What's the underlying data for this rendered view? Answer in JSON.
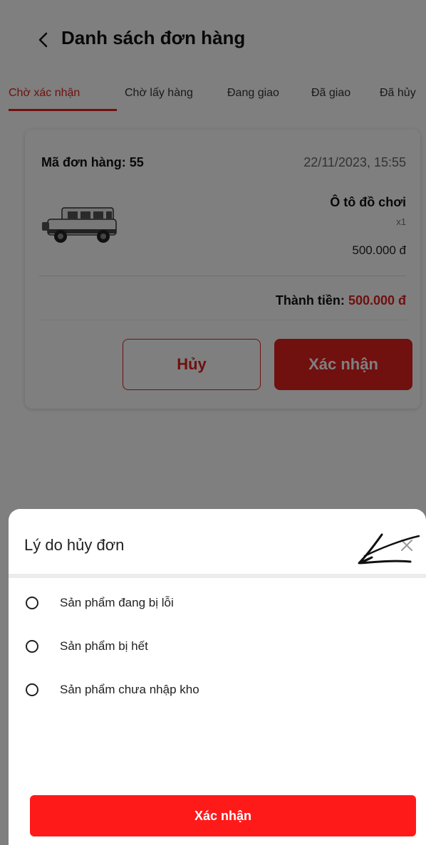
{
  "header": {
    "title": "Danh sách đơn hàng"
  },
  "tabs": [
    {
      "label": "Chờ xác nhận",
      "active": true
    },
    {
      "label": "Chờ lấy hàng"
    },
    {
      "label": "Đang giao"
    },
    {
      "label": "Đã giao"
    },
    {
      "label": "Đã hủy"
    }
  ],
  "order": {
    "id_label": "Mã đơn hàng: 55",
    "date": "22/11/2023, 15:55",
    "product_name": "Ô tô đồ chơi",
    "quantity": "x1",
    "price": "500.000 đ",
    "total_label": "Thành tiền:",
    "total_amount": "500.000 đ",
    "cancel_label": "Hủy",
    "confirm_label": "Xác nhận"
  },
  "cancel_sheet": {
    "title": "Lý do hủy đơn",
    "reasons": [
      {
        "label": "Sản phẩm đang bị lỗi"
      },
      {
        "label": "Sản phẩm bị hết"
      },
      {
        "label": "Sản phẩm chưa nhập kho"
      }
    ],
    "confirm_label": "Xác nhận"
  },
  "colors": {
    "accent": "#e0201f",
    "sheet_button": "#ff1a1a",
    "overlay": "rgba(0,0,0,0.5)"
  }
}
